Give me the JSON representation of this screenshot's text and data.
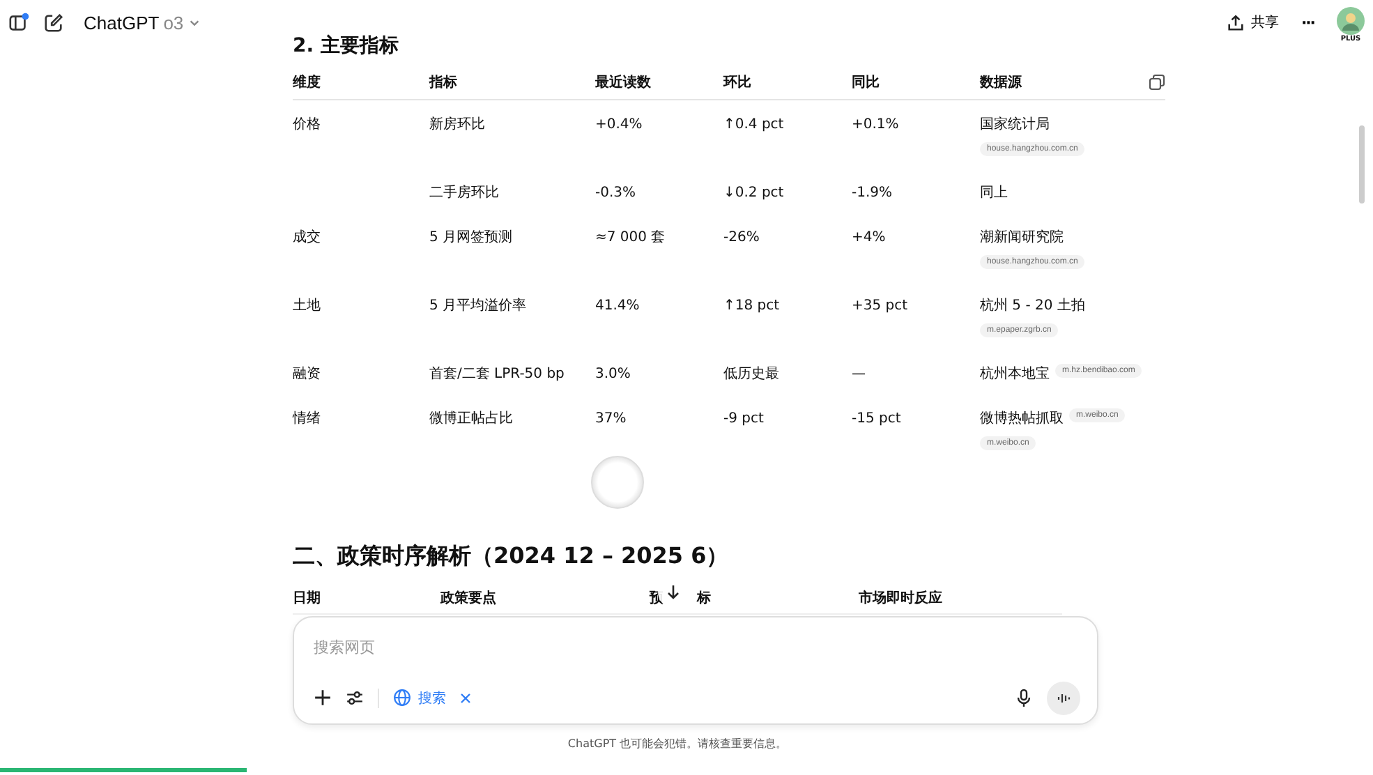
{
  "topbar": {
    "title": "ChatGPT",
    "model": "o3",
    "share": "共享",
    "more": "···",
    "badge": "PLUS"
  },
  "section_title": "2. 主要指标",
  "table": {
    "columns": [
      "维度",
      "指标",
      "最近读数",
      "环比",
      "同比",
      "数据源"
    ],
    "rows": [
      {
        "cells": [
          "价格",
          "新房环比",
          "+0.4%",
          "↑0.4 pct",
          "+0.1%"
        ],
        "source": "国家统计局",
        "links": [
          "house.hangzhou.com.cn"
        ]
      },
      {
        "cells": [
          "",
          "二手房环比",
          "-0.3%",
          "↓0.2 pct",
          "-1.9%"
        ],
        "source": "同上",
        "links": []
      },
      {
        "cells": [
          "成交",
          "5 月网签预测",
          "≈7 000 套",
          "-26%",
          "+4%"
        ],
        "source": "潮新闻研究院",
        "links": [
          "house.hangzhou.com.cn"
        ]
      },
      {
        "cells": [
          "土地",
          "5 月平均溢价率",
          "41.4%",
          "↑18 pct",
          "+35 pct"
        ],
        "source": "杭州 5 - 20 土拍",
        "links": [
          "m.epaper.zgrb.cn"
        ]
      },
      {
        "cells": [
          "融资",
          "首套/二套 LPR-50 bp",
          "3.0%",
          "低历史最",
          "—"
        ],
        "source": "杭州本地宝",
        "links": [
          "m.hz.bendibao.com"
        ]
      },
      {
        "cells": [
          "情绪",
          "微博正帖占比",
          "37%",
          "-9 pct",
          "-15 pct"
        ],
        "source": "微博热帖抓取",
        "links": [
          "m.weibo.cn",
          "m.weibo.cn"
        ]
      }
    ]
  },
  "heading2": "二、政策时序解析（2024 12 – 2025 6）",
  "table2": {
    "columns": [
      {
        "parts": [
          "日期"
        ]
      },
      {
        "parts": [
          "政策要点"
        ]
      },
      {
        "parts": [
          "预",
          "标"
        ]
      },
      {
        "parts": [
          "市场即时反应"
        ]
      }
    ]
  },
  "composer": {
    "placeholder": "搜索网页",
    "tool": "搜索",
    "tool_selected": true
  },
  "disclaimer": "ChatGPT 也可能会犯错。请核查重要信息。",
  "progress": {
    "level": 0.18
  }
}
